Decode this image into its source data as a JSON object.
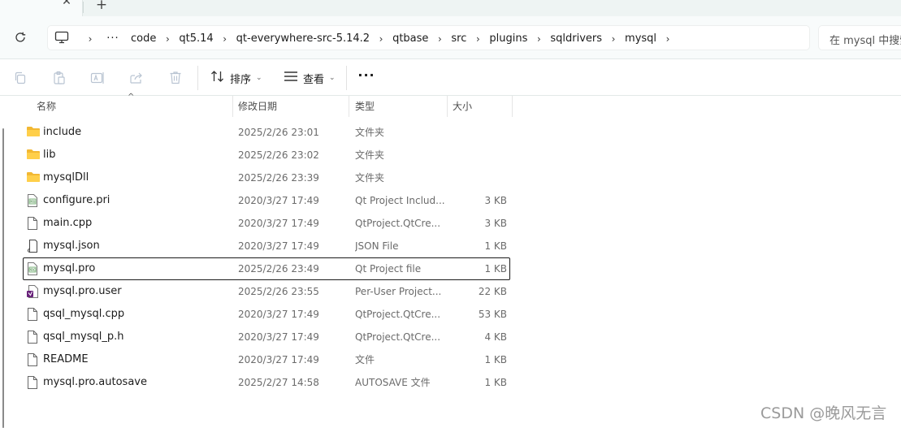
{
  "tabs": {
    "close_glyph": "✕",
    "new_glyph": "+"
  },
  "address": {
    "more": "···",
    "separator": "›",
    "crumbs": [
      "code",
      "qt5.14",
      "qt-everywhere-src-5.14.2",
      "qtbase",
      "src",
      "plugins",
      "sqldrivers",
      "mysql"
    ],
    "search_placeholder": "在 mysql 中搜索"
  },
  "toolbar": {
    "sort_label": "排序",
    "view_label": "查看",
    "more": "···",
    "icons": [
      "copy-icon",
      "paste-icon",
      "rename-icon",
      "share-icon",
      "delete-icon",
      "sort-icon",
      "view-icon"
    ]
  },
  "columns": {
    "name": "名称",
    "date": "修改日期",
    "type": "类型",
    "size": "大小"
  },
  "files": [
    {
      "name": "include",
      "date": "2025/2/26 23:01",
      "type": "文件夹",
      "size": "",
      "icon": "folder-icon"
    },
    {
      "name": "lib",
      "date": "2025/2/26 23:02",
      "type": "文件夹",
      "size": "",
      "icon": "folder-icon"
    },
    {
      "name": "mysqlDll",
      "date": "2025/2/26 23:39",
      "type": "文件夹",
      "size": "",
      "icon": "folder-icon"
    },
    {
      "name": "configure.pri",
      "date": "2020/3/27 17:49",
      "type": "Qt Project Includ...",
      "size": "3 KB",
      "icon": "pri-file-icon"
    },
    {
      "name": "main.cpp",
      "date": "2020/3/27 17:49",
      "type": "QtProject.QtCre...",
      "size": "3 KB",
      "icon": "file-icon"
    },
    {
      "name": "mysql.json",
      "date": "2020/3/27 17:49",
      "type": "JSON File",
      "size": "1 KB",
      "icon": "json-file-icon"
    },
    {
      "name": "mysql.pro",
      "date": "2025/2/26 23:49",
      "type": "Qt Project file",
      "size": "1 KB",
      "icon": "pro-file-icon",
      "selected": true
    },
    {
      "name": "mysql.pro.user",
      "date": "2025/2/26 23:55",
      "type": "Per-User Project...",
      "size": "22 KB",
      "icon": "vs-file-icon"
    },
    {
      "name": "qsql_mysql.cpp",
      "date": "2020/3/27 17:49",
      "type": "QtProject.QtCre...",
      "size": "53 KB",
      "icon": "file-icon"
    },
    {
      "name": "qsql_mysql_p.h",
      "date": "2020/3/27 17:49",
      "type": "QtProject.QtCre...",
      "size": "4 KB",
      "icon": "file-icon"
    },
    {
      "name": "README",
      "date": "2020/3/27 17:49",
      "type": "文件",
      "size": "1 KB",
      "icon": "file-icon"
    },
    {
      "name": "mysql.pro.autosave",
      "date": "2025/2/27 14:58",
      "type": "AUTOSAVE 文件",
      "size": "1 KB",
      "icon": "file-icon"
    }
  ],
  "watermark": "CSDN @晚风无言",
  "colors": {
    "folder": "#f4c542",
    "tabstrip": "#eef4f3",
    "selection_border": "#1b1b1b"
  }
}
